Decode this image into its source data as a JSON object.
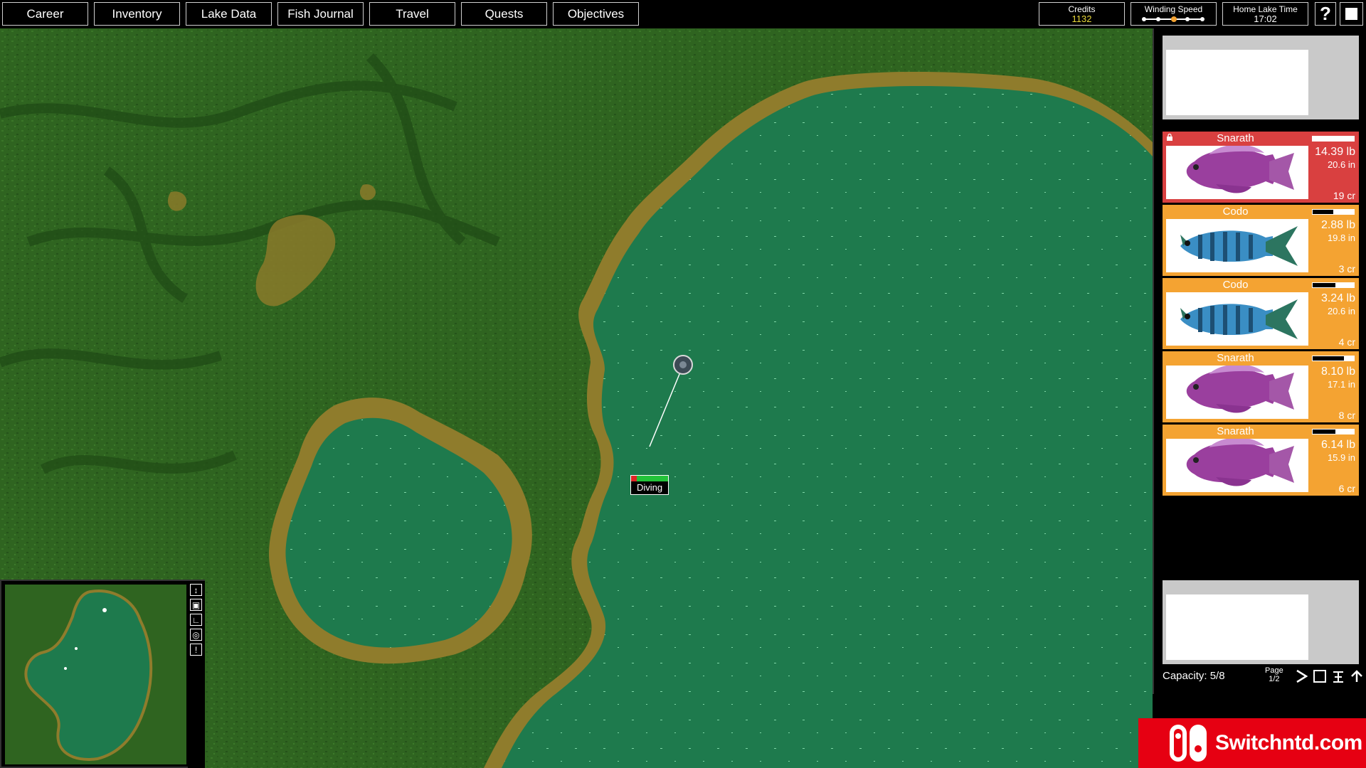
{
  "nav": [
    {
      "label": "Career"
    },
    {
      "label": "Inventory"
    },
    {
      "label": "Lake Data"
    },
    {
      "label": "Fish Journal"
    },
    {
      "label": "Travel"
    },
    {
      "label": "Quests"
    },
    {
      "label": "Objectives"
    }
  ],
  "stats": {
    "credits_label": "Credits",
    "credits_value": "1132",
    "winding_label": "Winding Speed",
    "winding_level": 3,
    "winding_levels": 5,
    "time_label": "Home Lake Time",
    "time_value": "17:02",
    "help_label": "?"
  },
  "colors": {
    "accent_orange": "#f4a332",
    "locked_red": "#d94040",
    "water": "#1d7a4c",
    "forest": "#2d5e1e",
    "shore": "#8a7a2a",
    "credits_text": "#e8d83a"
  },
  "lure": {
    "status": "Diving",
    "progress": 0.15
  },
  "catch": [
    {
      "name": "Snarath",
      "weight": "14.39 lb",
      "length": "20.6 in",
      "credits": "19 cr",
      "locked": true,
      "freshness": 0.0,
      "species": "snarath"
    },
    {
      "name": "Codo",
      "weight": "2.88 lb",
      "length": "19.8 in",
      "credits": "3 cr",
      "locked": false,
      "freshness": 0.5,
      "species": "codo"
    },
    {
      "name": "Codo",
      "weight": "3.24 lb",
      "length": "20.6 in",
      "credits": "4 cr",
      "locked": false,
      "freshness": 0.55,
      "species": "codo"
    },
    {
      "name": "Snarath",
      "weight": "8.10 lb",
      "length": "17.1 in",
      "credits": "8 cr",
      "locked": false,
      "freshness": 0.75,
      "species": "snarath"
    },
    {
      "name": "Snarath",
      "weight": "6.14 lb",
      "length": "15.9 in",
      "credits": "6 cr",
      "locked": false,
      "freshness": 0.55,
      "species": "snarath"
    }
  ],
  "capacity": "Capacity: 5/8",
  "page": {
    "label": "Page",
    "value": "1/2"
  },
  "minimap_tools": [
    "expand-icon",
    "layers-icon",
    "chart-icon",
    "target-icon",
    "alert-icon"
  ],
  "watermark": "Switchntd.com"
}
